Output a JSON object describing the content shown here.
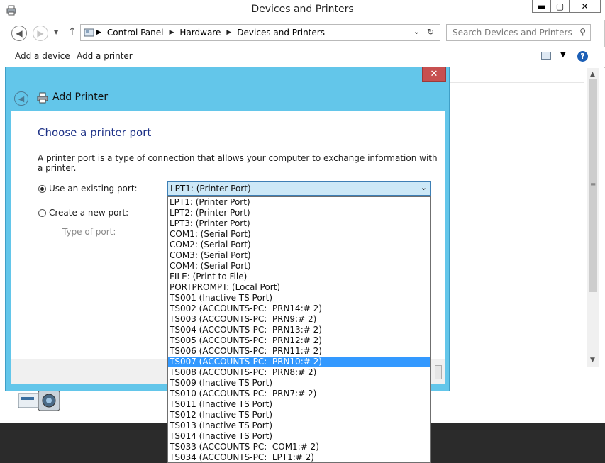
{
  "window": {
    "title": "Devices and Printers",
    "min_glyph": "▬",
    "max_glyph": "▢",
    "close_glyph": "✕"
  },
  "address_bar": {
    "breadcrumbs": [
      "Control Panel",
      "Hardware",
      "Devices and Printers"
    ],
    "separator": "▶",
    "search_placeholder": "Search Devices and Printers"
  },
  "toolbar": {
    "add_device": "Add a device",
    "add_printer": "Add a printer"
  },
  "dialog": {
    "title": "Add Printer",
    "heading": "Choose a printer port",
    "description": "A printer port is a type of connection that allows your computer to exchange information with a printer.",
    "use_existing_label": "Use an existing port:",
    "create_new_label": "Create a new port:",
    "type_of_port_label": "Type of port:",
    "selected_port": "LPT1: (Printer Port)",
    "use_existing_checked": true,
    "ports": [
      "LPT1: (Printer Port)",
      "LPT2: (Printer Port)",
      "LPT3: (Printer Port)",
      "COM1: (Serial Port)",
      "COM2: (Serial Port)",
      "COM3: (Serial Port)",
      "COM4: (Serial Port)",
      "FILE: (Print to File)",
      "PORTPROMPT: (Local Port)",
      "TS001 (Inactive TS Port)",
      "TS002 (ACCOUNTS-PC:  PRN14:# 2)",
      "TS003 (ACCOUNTS-PC:  PRN9:# 2)",
      "TS004 (ACCOUNTS-PC:  PRN13:# 2)",
      "TS005 (ACCOUNTS-PC:  PRN12:# 2)",
      "TS006 (ACCOUNTS-PC:  PRN11:# 2)",
      "TS007 (ACCOUNTS-PC:  PRN10:# 2)",
      "TS008 (ACCOUNTS-PC:  PRN8:# 2)",
      "TS009 (Inactive TS Port)",
      "TS010 (ACCOUNTS-PC:  PRN7:# 2)",
      "TS011 (Inactive TS Port)",
      "TS012 (Inactive TS Port)",
      "TS013 (Inactive TS Port)",
      "TS014 (Inactive TS Port)",
      "TS033 (ACCOUNTS-PC:  COM1:# 2)",
      "TS034 (ACCOUNTS-PC:  LPT1:# 2)"
    ],
    "highlighted_port": "TS007 (ACCOUNTS-PC:  PRN10:# 2)"
  },
  "colors": {
    "dialog_frame": "#63c6ea",
    "close_button": "#c75050",
    "heading": "#1e3287",
    "selection": "#3399ff"
  }
}
